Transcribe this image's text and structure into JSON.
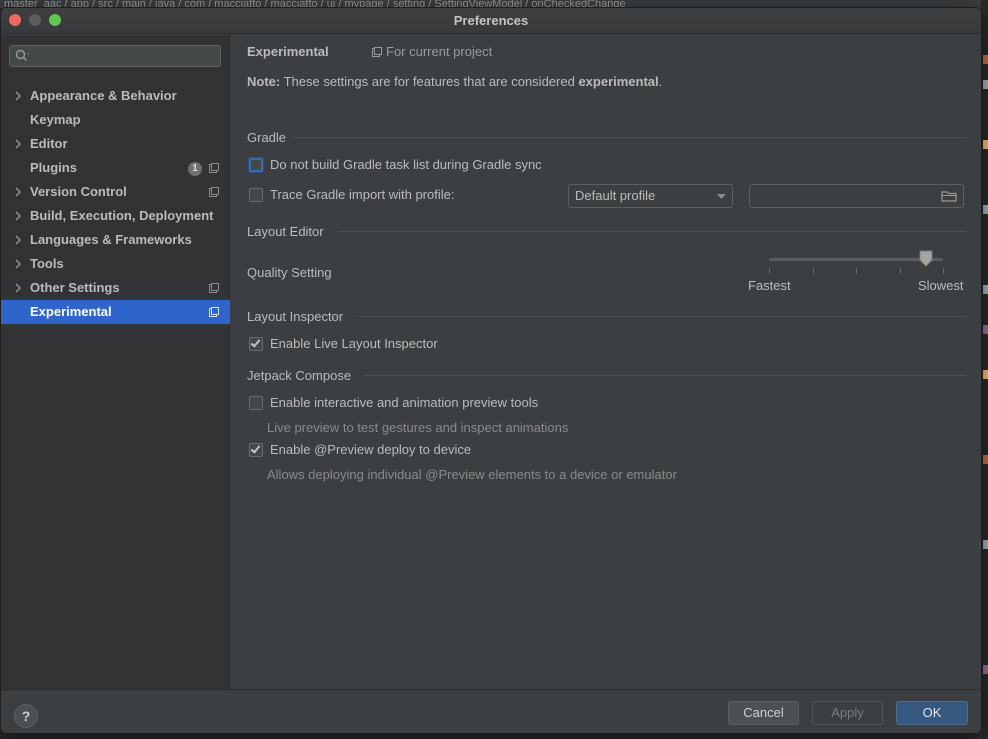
{
  "background_ide": {
    "breadcrumb": "master_aac  /  app  /  src  /  main  /  java  /  com  /  macciatto  /  macciatto  /  ui  /  mypage  /  setting  /  SettingViewModel  /  onCheckedChange"
  },
  "window": {
    "title": "Preferences"
  },
  "sidebar": {
    "search": {
      "value": "",
      "placeholder": ""
    },
    "items": [
      {
        "label": "Appearance & Behavior",
        "expandable": true,
        "project_scoped": false
      },
      {
        "label": "Keymap",
        "expandable": false,
        "project_scoped": false
      },
      {
        "label": "Editor",
        "expandable": true,
        "project_scoped": false
      },
      {
        "label": "Plugins",
        "expandable": false,
        "project_scoped": true,
        "badge": "1"
      },
      {
        "label": "Version Control",
        "expandable": true,
        "project_scoped": true
      },
      {
        "label": "Build, Execution, Deployment",
        "expandable": true,
        "project_scoped": false
      },
      {
        "label": "Languages & Frameworks",
        "expandable": true,
        "project_scoped": false
      },
      {
        "label": "Tools",
        "expandable": true,
        "project_scoped": false
      },
      {
        "label": "Other Settings",
        "expandable": true,
        "project_scoped": true
      },
      {
        "label": "Experimental",
        "expandable": false,
        "project_scoped": true,
        "selected": true
      }
    ]
  },
  "content": {
    "title": "Experimental",
    "scope_label": "For current project",
    "note": {
      "prefix": "Note:",
      "text": " These settings are for features that are considered ",
      "emphasis": "experimental",
      "suffix": "."
    },
    "gradle": {
      "title": "Gradle",
      "no_task_list": {
        "label": "Do not build Gradle task list during Gradle sync",
        "checked": false
      },
      "trace_import": {
        "label": "Trace Gradle import with profile:",
        "checked": false
      },
      "profile_dropdown": "Default profile",
      "profile_path": ""
    },
    "layout_editor": {
      "title": "Layout Editor",
      "quality_label": "Quality Setting",
      "slider_min": "Fastest",
      "slider_max": "Slowest",
      "slider_level": 0.9
    },
    "layout_inspector": {
      "title": "Layout Inspector",
      "live_inspector": {
        "label": "Enable Live Layout Inspector",
        "checked": true
      }
    },
    "jetpack_compose": {
      "title": "Jetpack Compose",
      "animation_preview": {
        "label": "Enable interactive and animation preview tools",
        "checked": false,
        "hint": "Live preview to test gestures and inspect animations"
      },
      "preview_deploy": {
        "label": "Enable @Preview deploy to device",
        "checked": true,
        "hint": "Allows deploying individual @Preview elements to a device or emulator"
      }
    }
  },
  "footer": {
    "help_label": "?",
    "cancel_label": "Cancel",
    "apply_label": "Apply",
    "ok_label": "OK"
  },
  "colors": {
    "selection": "#2f65ca",
    "ok_button": "#365880",
    "panel": "#3c3f41",
    "sidebar": "#313335"
  }
}
